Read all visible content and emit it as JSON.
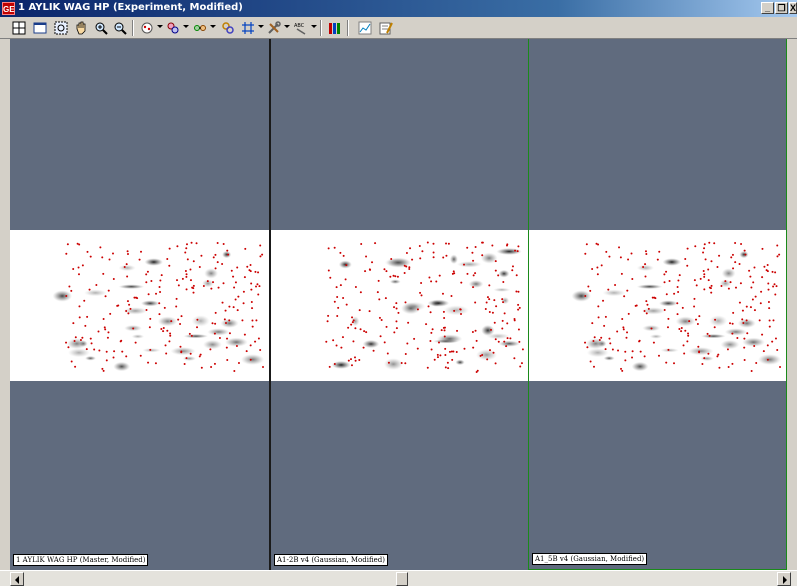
{
  "window": {
    "title": "1 AYLIK WAG HP (Experiment, Modified)",
    "app_icon_text": "GE",
    "minimize_label": "_",
    "restore_label": "❐",
    "close_label": "X"
  },
  "toolbar": {
    "buttons": [
      {
        "icon": "grid-layout-icon"
      },
      {
        "icon": "window-icon"
      },
      {
        "icon": "zoom-region-icon"
      },
      {
        "icon": "pan-hand-icon"
      },
      {
        "icon": "zoom-in-icon"
      },
      {
        "icon": "zoom-out-icon"
      },
      {
        "icon": "spot-detect-icon"
      },
      {
        "icon": "spot-edit-icon"
      },
      {
        "icon": "spot-match-icon"
      },
      {
        "icon": "link-spots-icon"
      },
      {
        "icon": "grid-overlay-icon"
      },
      {
        "icon": "tools-icon"
      },
      {
        "icon": "label-abc-icon"
      },
      {
        "icon": "color-bars-icon"
      },
      {
        "icon": "chart-icon"
      },
      {
        "icon": "report-edit-icon"
      }
    ]
  },
  "panes": [
    {
      "label": "1 AYLIK WAG HP (Master, Modified)",
      "seed": 11,
      "border_color": "#000000"
    },
    {
      "label": "A1-2B v4 (Gaussian, Modified)",
      "seed": 29,
      "border_color": "#1a8a1a"
    },
    {
      "label": "A1_5B v4 (Gaussian, Modified)",
      "seed": 11,
      "border_color": "#1a8a1a"
    }
  ],
  "colors": {
    "background": "#606b7e",
    "gel": "#ffffff",
    "spot_marker": "#cc0000"
  }
}
